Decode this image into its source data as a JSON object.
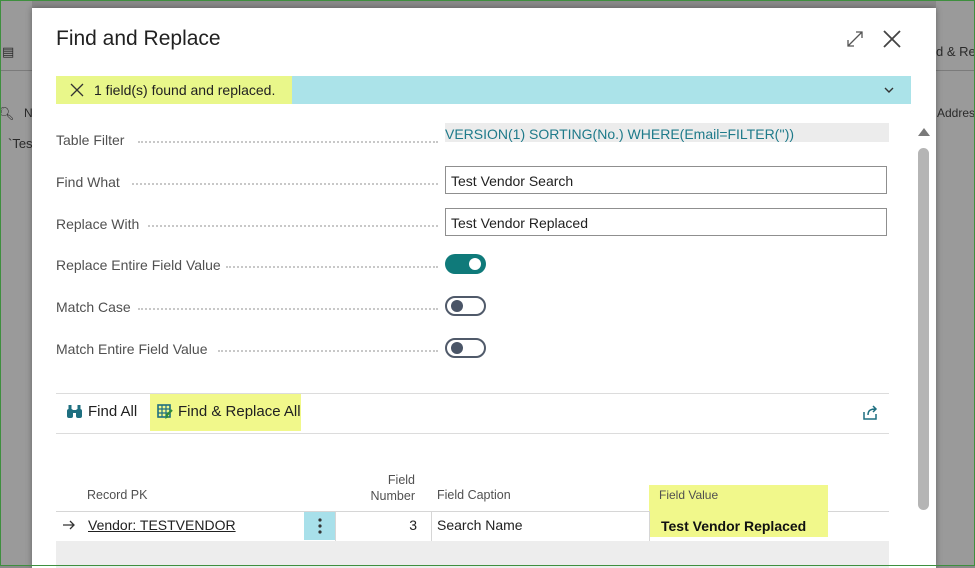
{
  "background": {
    "frag_top_right": "d & Re",
    "frag_addr": "Addres",
    "frag_n": "N",
    "frag_tes": "`Tes"
  },
  "dialog": {
    "title": "Find and Replace",
    "expand_icon": "expand-icon",
    "close_icon": "close-icon"
  },
  "notification": {
    "text": "1 field(s) found and replaced.",
    "dismiss_icon": "close-icon",
    "expand_icon": "chevron-down-icon",
    "bg_color": "#abe3e9"
  },
  "form": {
    "table_filter_label": "Table Filter",
    "table_filter_value": "VERSION(1) SORTING(No.) WHERE(Email=FILTER(''))",
    "find_what_label": "Find What",
    "find_what_value": "Test Vendor Search",
    "replace_with_label": "Replace With",
    "replace_with_value": "Test Vendor Replaced",
    "replace_entire_label": "Replace Entire Field Value",
    "replace_entire_on": true,
    "match_case_label": "Match Case",
    "match_case_on": false,
    "match_entire_label": "Match Entire Field Value",
    "match_entire_on": false
  },
  "actions": {
    "find_all_label": "Find All",
    "find_all_icon": "binoculars-icon",
    "find_replace_all_label": "Find & Replace All",
    "find_replace_all_icon": "replace-all-icon",
    "share_icon": "share-icon"
  },
  "grid": {
    "headers": {
      "record_pk": "Record PK",
      "field_number_line1": "Field",
      "field_number_line2": "Number",
      "field_caption": "Field Caption",
      "field_value": "Field Value"
    },
    "rows": [
      {
        "record_pk": "Vendor: TESTVENDOR",
        "field_number": "3",
        "field_caption": "Search Name",
        "field_value": "Test Vendor Replaced"
      }
    ]
  },
  "colors": {
    "accent": "#0f7a7a",
    "highlight": "#f1f88b",
    "link": "#1e7a8a"
  }
}
